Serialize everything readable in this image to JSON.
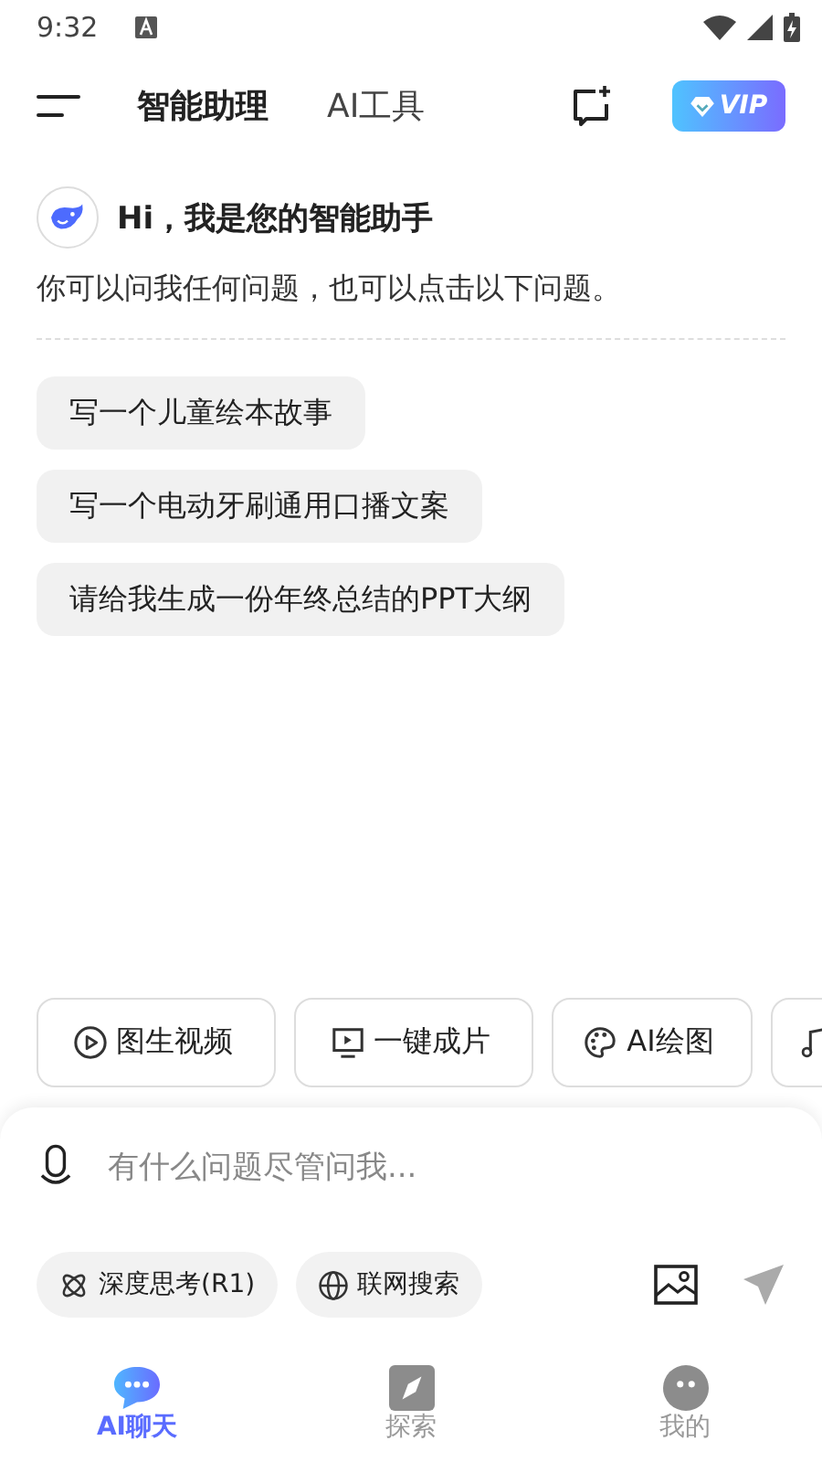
{
  "status_bar": {
    "time": "9:32"
  },
  "header": {
    "tabs": [
      {
        "label": "智能助理",
        "selected": true
      },
      {
        "label": "AI工具",
        "selected": false
      }
    ],
    "vip": "VIP"
  },
  "greeting": {
    "title": "Hi，我是您的智能助手",
    "subtitle": "你可以问我任何问题，也可以点击以下问题。"
  },
  "suggestions": [
    "写一个儿童绘本故事",
    "写一个电动牙刷通用口播文案",
    "请给我生成一份年终总结的PPT大纲"
  ],
  "tools": [
    {
      "kind": "play",
      "label": "图生视频"
    },
    {
      "kind": "screen",
      "label": "一键成片"
    },
    {
      "kind": "palette",
      "label": "AI绘图"
    },
    {
      "kind": "music"
    }
  ],
  "input": {
    "placeholder": "有什么问题尽管问我..."
  },
  "modes": [
    {
      "kind": "atom",
      "label": "深度思考(R1)"
    },
    {
      "kind": "globe",
      "label": "联网搜索"
    }
  ],
  "nav": [
    {
      "kind": "chat",
      "label": "AI聊天",
      "selected": true
    },
    {
      "kind": "compass",
      "label": "探索",
      "selected": false
    },
    {
      "kind": "me",
      "label": "我的",
      "selected": false
    }
  ]
}
